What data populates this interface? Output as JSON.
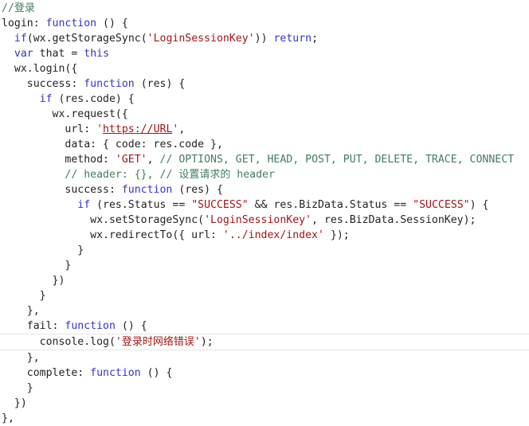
{
  "editor": {
    "language": "javascript",
    "background_color": "#ffffff",
    "colors": {
      "plain": "#232323",
      "keyword": "#3333CC",
      "comment": "#3F7F5F",
      "string": "#A31515",
      "link": "#A31515",
      "current_line_border": "#e4e4e4"
    },
    "highlighted_line_index": 22,
    "line_count": 27
  },
  "code": {
    "lines": [
      {
        "index": 0,
        "text": "//登录",
        "tokens": [
          {
            "t": "//",
            "k": "comment"
          },
          {
            "t": "登录",
            "k": "cjk-comment"
          }
        ]
      },
      {
        "index": 1,
        "text": "login: function () {",
        "tokens": [
          {
            "t": "login: ",
            "k": "plain"
          },
          {
            "t": "function",
            "k": "keyword"
          },
          {
            "t": " () {",
            "k": "plain"
          }
        ]
      },
      {
        "index": 2,
        "text": "  if(wx.getStorageSync('LoginSessionKey')) return;",
        "tokens": [
          {
            "t": "  ",
            "k": "plain"
          },
          {
            "t": "if",
            "k": "keyword"
          },
          {
            "t": "(wx.getStorageSync(",
            "k": "plain"
          },
          {
            "t": "'LoginSessionKey'",
            "k": "string"
          },
          {
            "t": ")) ",
            "k": "plain"
          },
          {
            "t": "return",
            "k": "keyword"
          },
          {
            "t": ";",
            "k": "plain"
          }
        ]
      },
      {
        "index": 3,
        "text": "  var that = this",
        "tokens": [
          {
            "t": "  ",
            "k": "plain"
          },
          {
            "t": "var",
            "k": "keyword"
          },
          {
            "t": " that = ",
            "k": "plain"
          },
          {
            "t": "this",
            "k": "keyword"
          }
        ]
      },
      {
        "index": 4,
        "text": "  wx.login({",
        "tokens": [
          {
            "t": "  wx.login({",
            "k": "plain"
          }
        ]
      },
      {
        "index": 5,
        "text": "    success: function (res) {",
        "tokens": [
          {
            "t": "    success: ",
            "k": "plain"
          },
          {
            "t": "function",
            "k": "keyword"
          },
          {
            "t": " (res) {",
            "k": "plain"
          }
        ]
      },
      {
        "index": 6,
        "text": "      if (res.code) {",
        "tokens": [
          {
            "t": "      ",
            "k": "plain"
          },
          {
            "t": "if",
            "k": "keyword"
          },
          {
            "t": " (res.code) {",
            "k": "plain"
          }
        ]
      },
      {
        "index": 7,
        "text": "        wx.request({",
        "tokens": [
          {
            "t": "        wx.request({",
            "k": "plain"
          }
        ]
      },
      {
        "index": 8,
        "text": "          url: 'https://URL',",
        "tokens": [
          {
            "t": "          url: ",
            "k": "plain"
          },
          {
            "t": "'",
            "k": "string"
          },
          {
            "t": "https://URL",
            "k": "link"
          },
          {
            "t": "'",
            "k": "string"
          },
          {
            "t": ",",
            "k": "plain"
          }
        ]
      },
      {
        "index": 9,
        "text": "          data: { code: res.code },",
        "tokens": [
          {
            "t": "          data: { code: res.code },",
            "k": "plain"
          }
        ]
      },
      {
        "index": 10,
        "text": "          method: 'GET', // OPTIONS, GET, HEAD, POST, PUT, DELETE, TRACE, CONNECT",
        "tokens": [
          {
            "t": "          method: ",
            "k": "plain"
          },
          {
            "t": "'GET'",
            "k": "string"
          },
          {
            "t": ", ",
            "k": "plain"
          },
          {
            "t": "// OPTIONS, GET, HEAD, POST, PUT, DELETE, TRACE, CONNECT",
            "k": "comment"
          }
        ]
      },
      {
        "index": 11,
        "text": "          // header: {}, // 设置请求的 header",
        "tokens": [
          {
            "t": "          ",
            "k": "plain"
          },
          {
            "t": "// header: {}, // ",
            "k": "comment"
          },
          {
            "t": "设置请求的",
            "k": "cjk-comment"
          },
          {
            "t": " header",
            "k": "comment"
          }
        ]
      },
      {
        "index": 12,
        "text": "          success: function (res) {",
        "tokens": [
          {
            "t": "          success: ",
            "k": "plain"
          },
          {
            "t": "function",
            "k": "keyword"
          },
          {
            "t": " (res) {",
            "k": "plain"
          }
        ]
      },
      {
        "index": 13,
        "text": "            if (res.Status == \"SUCCESS\" && res.BizData.Status == \"SUCCESS\") {",
        "tokens": [
          {
            "t": "            ",
            "k": "plain"
          },
          {
            "t": "if",
            "k": "keyword"
          },
          {
            "t": " (res.Status == ",
            "k": "plain"
          },
          {
            "t": "\"SUCCESS\"",
            "k": "string"
          },
          {
            "t": " && res.BizData.Status == ",
            "k": "plain"
          },
          {
            "t": "\"SUCCESS\"",
            "k": "string"
          },
          {
            "t": ") {",
            "k": "plain"
          }
        ]
      },
      {
        "index": 14,
        "text": "              wx.setStorageSync('LoginSessionKey', res.BizData.SessionKey);",
        "tokens": [
          {
            "t": "              wx.setStorageSync(",
            "k": "plain"
          },
          {
            "t": "'LoginSessionKey'",
            "k": "string"
          },
          {
            "t": ", res.BizData.SessionKey);",
            "k": "plain"
          }
        ]
      },
      {
        "index": 15,
        "text": "              wx.redirectTo({ url: '../index/index' });",
        "tokens": [
          {
            "t": "              wx.redirectTo({ url: ",
            "k": "plain"
          },
          {
            "t": "'../index/index'",
            "k": "string"
          },
          {
            "t": " });",
            "k": "plain"
          }
        ]
      },
      {
        "index": 16,
        "text": "            }",
        "tokens": [
          {
            "t": "            }",
            "k": "plain"
          }
        ]
      },
      {
        "index": 17,
        "text": "          }",
        "tokens": [
          {
            "t": "          }",
            "k": "plain"
          }
        ]
      },
      {
        "index": 18,
        "text": "        })",
        "tokens": [
          {
            "t": "        })",
            "k": "plain"
          }
        ]
      },
      {
        "index": 19,
        "text": "      }",
        "tokens": [
          {
            "t": "      }",
            "k": "plain"
          }
        ]
      },
      {
        "index": 20,
        "text": "    },",
        "tokens": [
          {
            "t": "    },",
            "k": "plain"
          }
        ]
      },
      {
        "index": 21,
        "text": "    fail: function () {",
        "tokens": [
          {
            "t": "    fail: ",
            "k": "plain"
          },
          {
            "t": "function",
            "k": "keyword"
          },
          {
            "t": " () {",
            "k": "plain"
          }
        ]
      },
      {
        "index": 22,
        "text": "      console.log('登录时网络错误');",
        "highlighted": true,
        "tokens": [
          {
            "t": "      console.log(",
            "k": "plain"
          },
          {
            "t": "'",
            "k": "string"
          },
          {
            "t": "登录时网络错误",
            "k": "cjk-string"
          },
          {
            "t": "'",
            "k": "string"
          },
          {
            "t": ");",
            "k": "plain"
          }
        ]
      },
      {
        "index": 23,
        "text": "    },",
        "tokens": [
          {
            "t": "    },",
            "k": "plain"
          }
        ]
      },
      {
        "index": 24,
        "text": "    complete: function () {",
        "tokens": [
          {
            "t": "    complete: ",
            "k": "plain"
          },
          {
            "t": "function",
            "k": "keyword"
          },
          {
            "t": " () {",
            "k": "plain"
          }
        ]
      },
      {
        "index": 25,
        "text": "    }",
        "tokens": [
          {
            "t": "    }",
            "k": "plain"
          }
        ]
      },
      {
        "index": 26,
        "text": "  })",
        "tokens": [
          {
            "t": "  })",
            "k": "plain"
          }
        ]
      },
      {
        "index": 27,
        "text": "},",
        "tokens": [
          {
            "t": "},",
            "k": "plain"
          }
        ]
      }
    ]
  }
}
